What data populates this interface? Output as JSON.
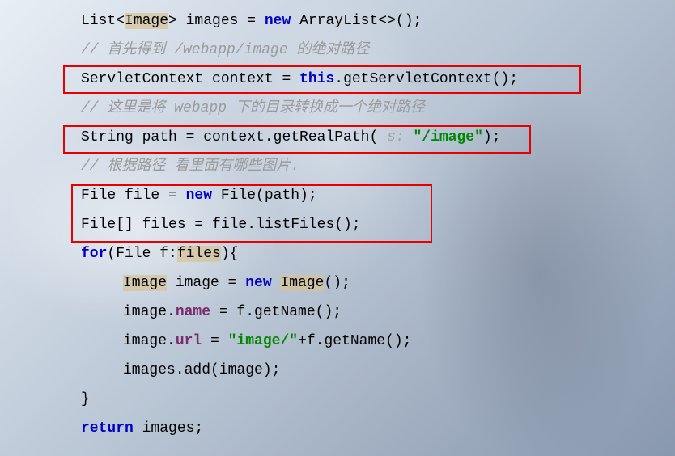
{
  "code": {
    "line1": {
      "prefix": "List<",
      "hlType": "Image",
      "afterType": "> images = ",
      "kwNew": "new",
      "suffix": " ArrayList<>();"
    },
    "line2": {
      "comment": "// 首先得到 /webapp/image 的绝对路径"
    },
    "line3": {
      "p1": "ServletContext context = ",
      "kwThis": "this",
      "p2": ".getServletContext();"
    },
    "line4": {
      "comment": "// 这里是将 webapp 下的目录转换成一个绝对路径"
    },
    "line5": {
      "p1": "String path = context.getRealPath(",
      "hint": " s: ",
      "str": "\"/image\"",
      "p2": ");"
    },
    "line6": {
      "comment": "// 根据路径 看里面有哪些图片."
    },
    "line7": {
      "p1": "File file = ",
      "kwNew": "new",
      "p2": " File(path);"
    },
    "line8": {
      "p1": "File[] files = file.listFiles();"
    },
    "line9": {
      "kwFor": "for",
      "p1": "(File f:",
      "hlVar": "files",
      "p2": "){"
    },
    "line10": {
      "hlType": "Image",
      "p1": " image = ",
      "kwNew": "new",
      "p2": " ",
      "hlType2": "Image",
      "p3": "();"
    },
    "line11": {
      "p1": "image.",
      "member": "name",
      "p2": " = f.getName();"
    },
    "line12": {
      "p1": "image.",
      "member": "url",
      "p2": " = ",
      "str": "\"image/\"",
      "p3": "+f.getName();"
    },
    "line13": {
      "p1": "images.add(image);"
    },
    "line14": {
      "brace": "}"
    },
    "line15": {
      "kwReturn": "return",
      "p1": " images;"
    }
  }
}
